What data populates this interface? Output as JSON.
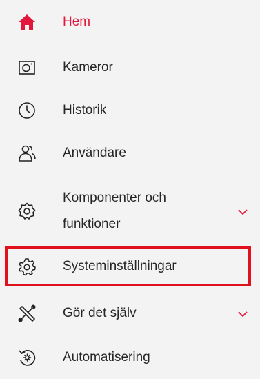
{
  "menu": {
    "accent_color": "#e2173b",
    "highlight_color": "#e0101d",
    "items": [
      {
        "label": "Hem",
        "icon": "home-icon",
        "active": true,
        "expandable": false
      },
      {
        "label": "Kameror",
        "icon": "camera-icon",
        "active": false,
        "expandable": false
      },
      {
        "label": "Historik",
        "icon": "clock-icon",
        "active": false,
        "expandable": false
      },
      {
        "label": "Användare",
        "icon": "users-icon",
        "active": false,
        "expandable": false
      },
      {
        "label": "Komponenter och funktioner",
        "icon": "component-gear-icon",
        "active": false,
        "expandable": true
      },
      {
        "label": "Systeminställningar",
        "icon": "settings-gear-icon",
        "active": false,
        "expandable": false,
        "highlighted": true
      },
      {
        "label": "Gör det själv",
        "icon": "tools-icon",
        "active": false,
        "expandable": true
      },
      {
        "label": "Automatisering",
        "icon": "automation-icon",
        "active": false,
        "expandable": false
      }
    ]
  }
}
